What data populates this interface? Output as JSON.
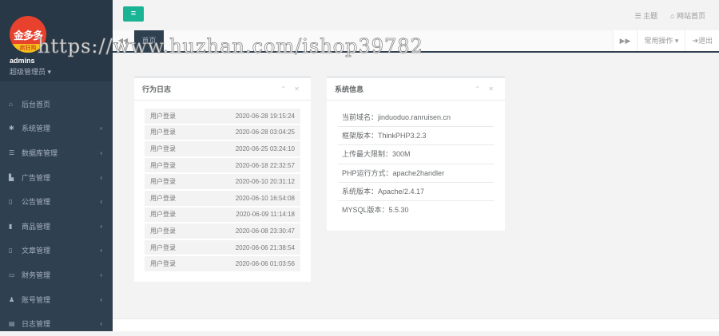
{
  "sidebar": {
    "logo_text": "金多多",
    "logo_band": "疯狂购",
    "username": "admins",
    "role": "超级管理员 ▾",
    "items": [
      {
        "label": "后台首页",
        "icon": "home-icon",
        "glyph": "⌂",
        "chevron": ""
      },
      {
        "label": "系统管理",
        "icon": "gear-icon",
        "glyph": "✱",
        "chevron": "‹"
      },
      {
        "label": "数据库管理",
        "icon": "database-icon",
        "glyph": "☰",
        "chevron": "‹"
      },
      {
        "label": "广告管理",
        "icon": "copy-icon",
        "glyph": "▙",
        "chevron": "‹"
      },
      {
        "label": "公告管理",
        "icon": "file-icon",
        "glyph": "▯",
        "chevron": "‹"
      },
      {
        "label": "商品管理",
        "icon": "file-solid-icon",
        "glyph": "▮",
        "chevron": "‹"
      },
      {
        "label": "文章管理",
        "icon": "file-icon",
        "glyph": "▯",
        "chevron": "‹"
      },
      {
        "label": "财务管理",
        "icon": "money-icon",
        "glyph": "▭",
        "chevron": "‹"
      },
      {
        "label": "账号管理",
        "icon": "user-icon",
        "glyph": "♟",
        "chevron": "‹"
      },
      {
        "label": "日志管理",
        "icon": "file-text-icon",
        "glyph": "▤",
        "chevron": "‹"
      }
    ]
  },
  "topbar": {
    "menu_glyph": "≡",
    "theme": "☰ 主题",
    "site_home": "⌂ 网站首页"
  },
  "tabbar": {
    "back": "◀◀",
    "active_tab": "首页",
    "forward": "▶▶",
    "common_ops": "常用操作 ▾",
    "logout": "➜退出"
  },
  "log_panel": {
    "title": "行为日志",
    "tools": "⌃ ✕",
    "rows": [
      {
        "action": "用户登录",
        "time": "2020-06-28 19:15:24"
      },
      {
        "action": "用户登录",
        "time": "2020-06-28 03:04:25"
      },
      {
        "action": "用户登录",
        "time": "2020-06-25 03:24:10"
      },
      {
        "action": "用户登录",
        "time": "2020-06-18 22:32:57"
      },
      {
        "action": "用户登录",
        "time": "2020-06-10 20:31:12"
      },
      {
        "action": "用户登录",
        "time": "2020-06-10 16:54:08"
      },
      {
        "action": "用户登录",
        "time": "2020-06-09 11:14:18"
      },
      {
        "action": "用户登录",
        "time": "2020-06-08 23:30:47"
      },
      {
        "action": "用户登录",
        "time": "2020-06-06 21:38:54"
      },
      {
        "action": "用户登录",
        "time": "2020-06-06 01:03:56"
      }
    ]
  },
  "info_panel": {
    "title": "系统信息",
    "tools": "⌃ ✕",
    "rows": [
      "当前域名：jinduoduo.ranruisen.cn",
      "框架版本：ThinkPHP3.2.3",
      "上传最大限制：300M",
      "PHP运行方式：apache2handler",
      "系统版本：Apache/2.4.17",
      "MYSQL版本：5.5.30"
    ]
  },
  "watermark": "https://www.huzhan.com/ishop39782",
  "colors": {
    "sidebar": "#2f4050",
    "accent": "#1ab394",
    "bg": "#f3f3f4"
  }
}
